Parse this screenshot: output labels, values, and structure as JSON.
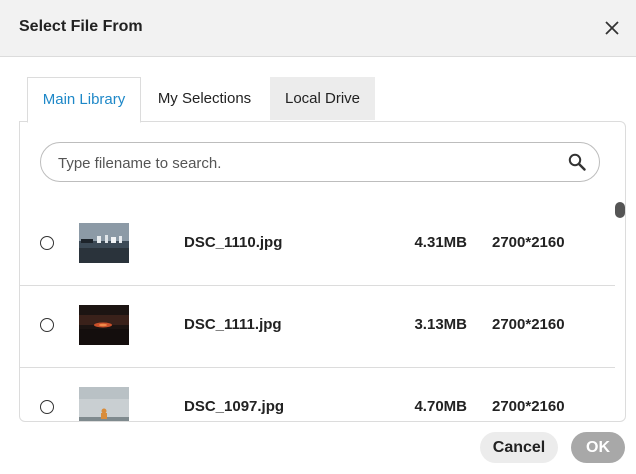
{
  "dialog": {
    "title": "Select File From",
    "close_icon": "close-icon"
  },
  "tabs": [
    {
      "label": "Main Library",
      "active": true
    },
    {
      "label": "My Selections",
      "active": false
    },
    {
      "label": "Local Drive",
      "active": false
    }
  ],
  "search": {
    "placeholder": "Type filename to search.",
    "value": "",
    "icon": "search-icon"
  },
  "files": [
    {
      "name": "DSC_1110.jpg",
      "size": "4.31MB",
      "dimensions": "2700*2160",
      "selected": false
    },
    {
      "name": "DSC_1111.jpg",
      "size": "3.13MB",
      "dimensions": "2700*2160",
      "selected": false
    },
    {
      "name": "DSC_1097.jpg",
      "size": "4.70MB",
      "dimensions": "2700*2160",
      "selected": false
    }
  ],
  "buttons": {
    "cancel": "Cancel",
    "ok": "OK"
  },
  "colors": {
    "accent": "#1e88c8",
    "ok_disabled": "#a8a8a8",
    "header_bg": "#f2f2f2"
  }
}
